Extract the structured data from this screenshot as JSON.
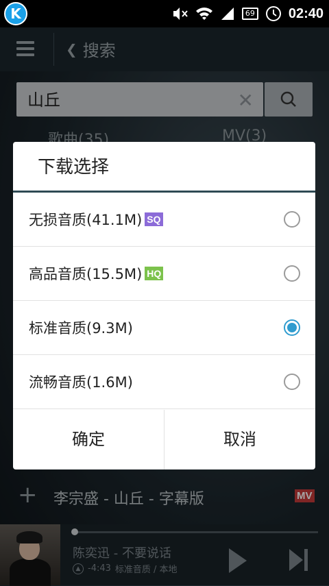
{
  "status_bar": {
    "app_letter": "K",
    "battery": "69",
    "time": "02:40"
  },
  "topbar": {
    "back_label": "搜索"
  },
  "search": {
    "value": "山丘"
  },
  "tabs": [
    {
      "label": "歌曲(35)"
    },
    {
      "label": "MV(3)"
    }
  ],
  "dialog": {
    "title": "下载选择",
    "options": [
      {
        "label": "无损音质(41.1M)",
        "badge": "SQ",
        "selected": false
      },
      {
        "label": "高品音质(15.5M)",
        "badge": "HQ",
        "selected": false
      },
      {
        "label": "标准音质(9.3M)",
        "badge": "",
        "selected": true
      },
      {
        "label": "流畅音质(1.6M)",
        "badge": "",
        "selected": false
      }
    ],
    "confirm_label": "确定",
    "cancel_label": "取消"
  },
  "list_item": {
    "title": "李宗盛 - 山丘 - 字幕版",
    "badge": "MV"
  },
  "player": {
    "title": "陈奕迅 - 不要说话",
    "time": "-4:43",
    "quality": "标准音质 / 本地",
    "progress": 0.0
  },
  "colors": {
    "accent": "#2f9ccf",
    "sq_badge": "#8c6bd8",
    "hq_badge": "#7cc24c",
    "mv_badge": "#c43a3a"
  }
}
